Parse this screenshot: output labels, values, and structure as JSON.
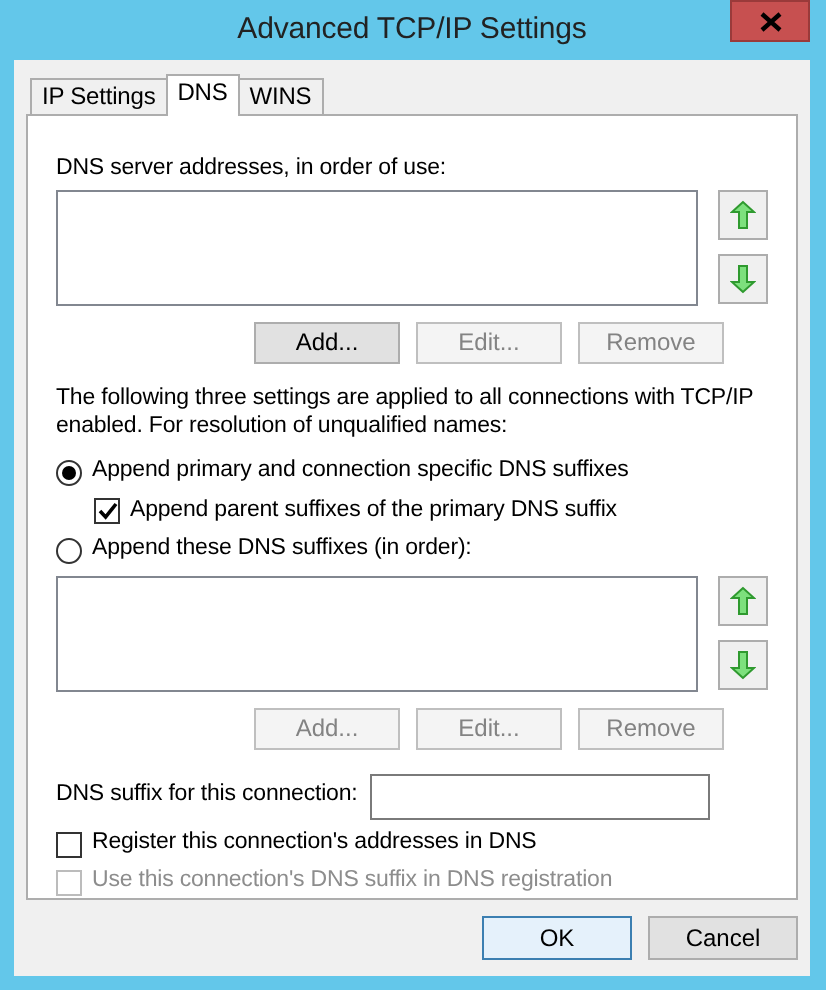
{
  "window": {
    "title": "Advanced TCP/IP Settings"
  },
  "tabs": [
    {
      "label": "IP Settings",
      "selected": false
    },
    {
      "label": "DNS",
      "selected": true
    },
    {
      "label": "WINS",
      "selected": false
    }
  ],
  "dns_servers": {
    "label": "DNS server addresses, in order of use:",
    "buttons": [
      {
        "label": "Add...",
        "disabled": false
      },
      {
        "label": "Edit...",
        "disabled": true
      },
      {
        "label": "Remove",
        "disabled": true
      }
    ]
  },
  "description": "The following three settings are applied to all connections with TCP/IP enabled. For resolution of unqualified names:",
  "options": [
    {
      "kind": "radio",
      "label": "Append primary and connection specific DNS suffixes",
      "selected": true,
      "children": [
        {
          "kind": "checkbox",
          "label": "Append parent suffixes of the primary DNS suffix",
          "checked": true,
          "disabled": false
        }
      ]
    },
    {
      "kind": "radio",
      "label": "Append these DNS suffixes (in order):",
      "selected": false
    }
  ],
  "suffixes": {
    "buttons": [
      {
        "label": "Add...",
        "disabled": true
      },
      {
        "label": "Edit...",
        "disabled": true
      },
      {
        "label": "Remove",
        "disabled": true
      }
    ]
  },
  "suffix_field": {
    "label": "DNS suffix for this connection:"
  },
  "registration": [
    {
      "label": "Register this connection's addresses in DNS",
      "checked": false,
      "disabled": false
    },
    {
      "label": "Use this connection's DNS suffix in DNS registration",
      "checked": false,
      "disabled": true
    }
  ],
  "dialog_buttons": [
    {
      "label": "OK",
      "default": true
    },
    {
      "label": "Cancel",
      "default": false
    }
  ]
}
